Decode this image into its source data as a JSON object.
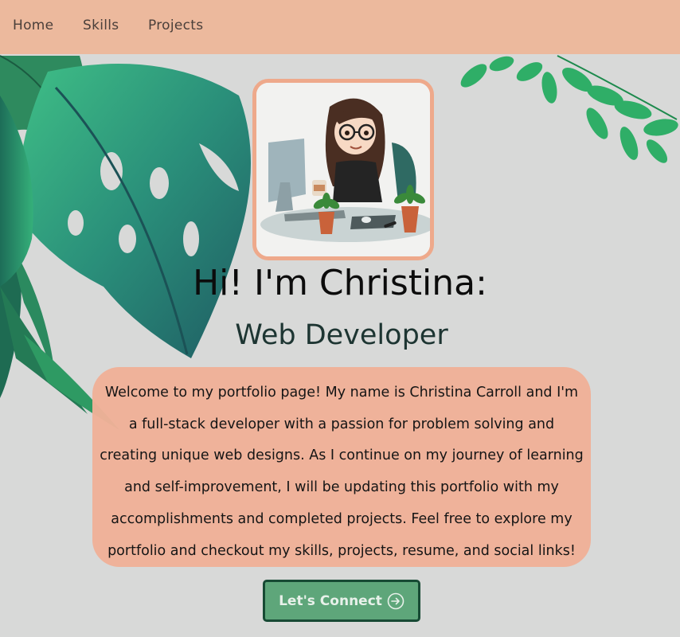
{
  "nav": {
    "items": [
      {
        "label": "Home"
      },
      {
        "label": "Skills"
      },
      {
        "label": "Projects"
      }
    ]
  },
  "hero": {
    "avatar_icon": "developer-avatar-illustration",
    "title": "Hi! I'm Christina:",
    "subtitle": "Web Developer"
  },
  "intro": {
    "text": "Welcome to my portfolio page! My name is Christina Carroll and I'm a full-stack developer with a passion for problem solving and creating unique web designs. As I continue on my journey of learning and self-improvement, I will be updating this portfolio with my accomplishments and completed projects. Feel free to explore my portfolio and checkout my skills, projects, resume, and social links!"
  },
  "cta": {
    "label": "Let's Connect",
    "icon": "arrow-right-circle-icon"
  },
  "colors": {
    "nav_background": "#ecb99d",
    "page_background": "#d8d9d8",
    "card_background": "#f0b198",
    "button_background": "#5ea67a",
    "button_border": "#174a34"
  }
}
